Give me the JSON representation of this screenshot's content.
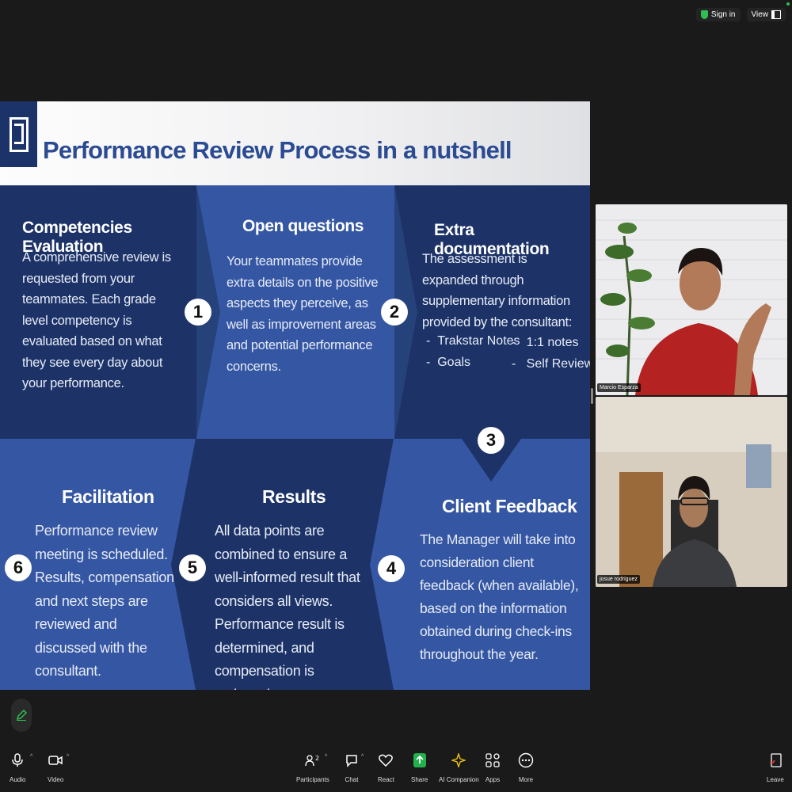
{
  "topbar": {
    "signin_label": "Sign in",
    "view_label": "View"
  },
  "slide": {
    "title": "Performance Review Process in a nutshell",
    "steps": [
      {
        "title": "Competencies Evaluation",
        "number": "1",
        "body": "A comprehensive review is requested from your teammates. Each grade level competency is evaluated based on what they see every day about your performance."
      },
      {
        "title": "Open questions",
        "number": "2",
        "body": "Your teammates provide extra details on the positive aspects they perceive, as well as improvement areas and potential performance concerns."
      },
      {
        "title": "Extra documentation",
        "number": "3",
        "body": "The assessment is expanded through supplementary information provided by the consultant:",
        "bullets": [
          "Trakstar Notes",
          "Goals",
          "1:1 notes",
          "Self Review"
        ]
      },
      {
        "title": "Client Feedback",
        "number": "4",
        "body": "The Manager will take into consideration client feedback (when available), based on the information obtained during check-ins throughout the year."
      },
      {
        "title": "Results",
        "number": "5",
        "body": "All data points are combined to ensure a well-informed result that considers all views. Performance result is determined, and compensation is reviewed."
      },
      {
        "title": "Facilitation",
        "number": "6",
        "body": "Performance review meeting is scheduled. Results, compensation and next steps are reviewed and discussed with the consultant."
      }
    ]
  },
  "participants": [
    {
      "name": "Marcio Esparza"
    },
    {
      "name": "josue rodriguez"
    }
  ],
  "toolbar": {
    "audio": "Audio",
    "video": "Video",
    "participants": "Participants",
    "participants_count": "2",
    "chat": "Chat",
    "react": "React",
    "share": "Share",
    "ai_companion": "AI Companion",
    "apps": "Apps",
    "more": "More",
    "leave": "Leave"
  },
  "colors": {
    "dark_blue": "#1d3368",
    "mid_blue": "#26427a",
    "light_blue": "#3557a3",
    "share_green": "#23b04d"
  }
}
